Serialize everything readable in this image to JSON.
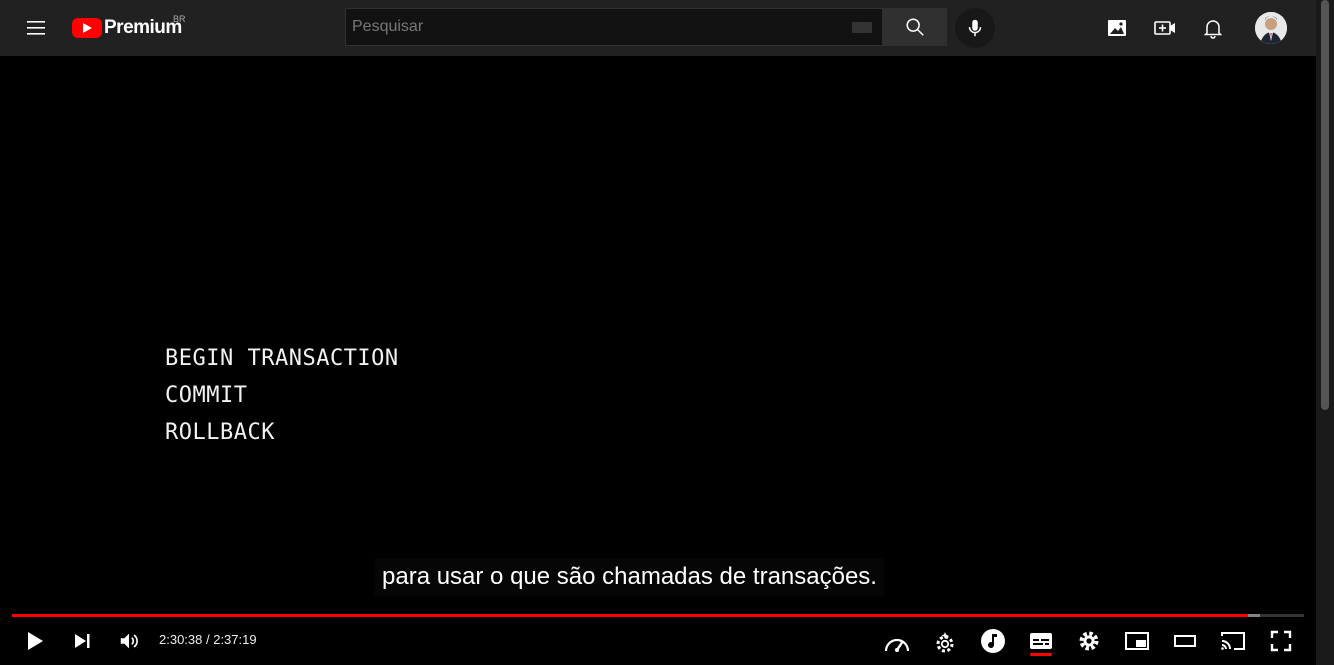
{
  "header": {
    "logo_text": "Premium",
    "region": "BR",
    "search_placeholder": "Pesquisar"
  },
  "video": {
    "slide_lines": [
      "BEGIN TRANSACTION",
      "COMMIT",
      "ROLLBACK"
    ],
    "caption": "para usar o que são chamadas de transações.",
    "current_time": "2:30:38",
    "duration": "2:37:19",
    "time_separator": " / ",
    "played_fraction": 0.957,
    "loaded_fraction": 0.966
  },
  "colors": {
    "accent": "#ff0000",
    "topbar": "#212121",
    "background": "#000000"
  },
  "icons": {
    "menu": "menu-icon",
    "search": "search-icon",
    "mic": "mic-icon",
    "create_post": "image-icon",
    "create": "video-plus-icon",
    "notifications": "bell-icon",
    "play": "play-icon",
    "next": "next-icon",
    "volume": "volume-icon",
    "speed": "speedometer-icon",
    "quality": "gear-sparkle-icon",
    "music": "music-note-icon",
    "subtitles": "subtitles-icon",
    "settings": "gear-icon",
    "miniplayer": "miniplayer-icon",
    "theater": "theater-icon",
    "cast": "cast-icon",
    "fullscreen": "fullscreen-icon"
  }
}
